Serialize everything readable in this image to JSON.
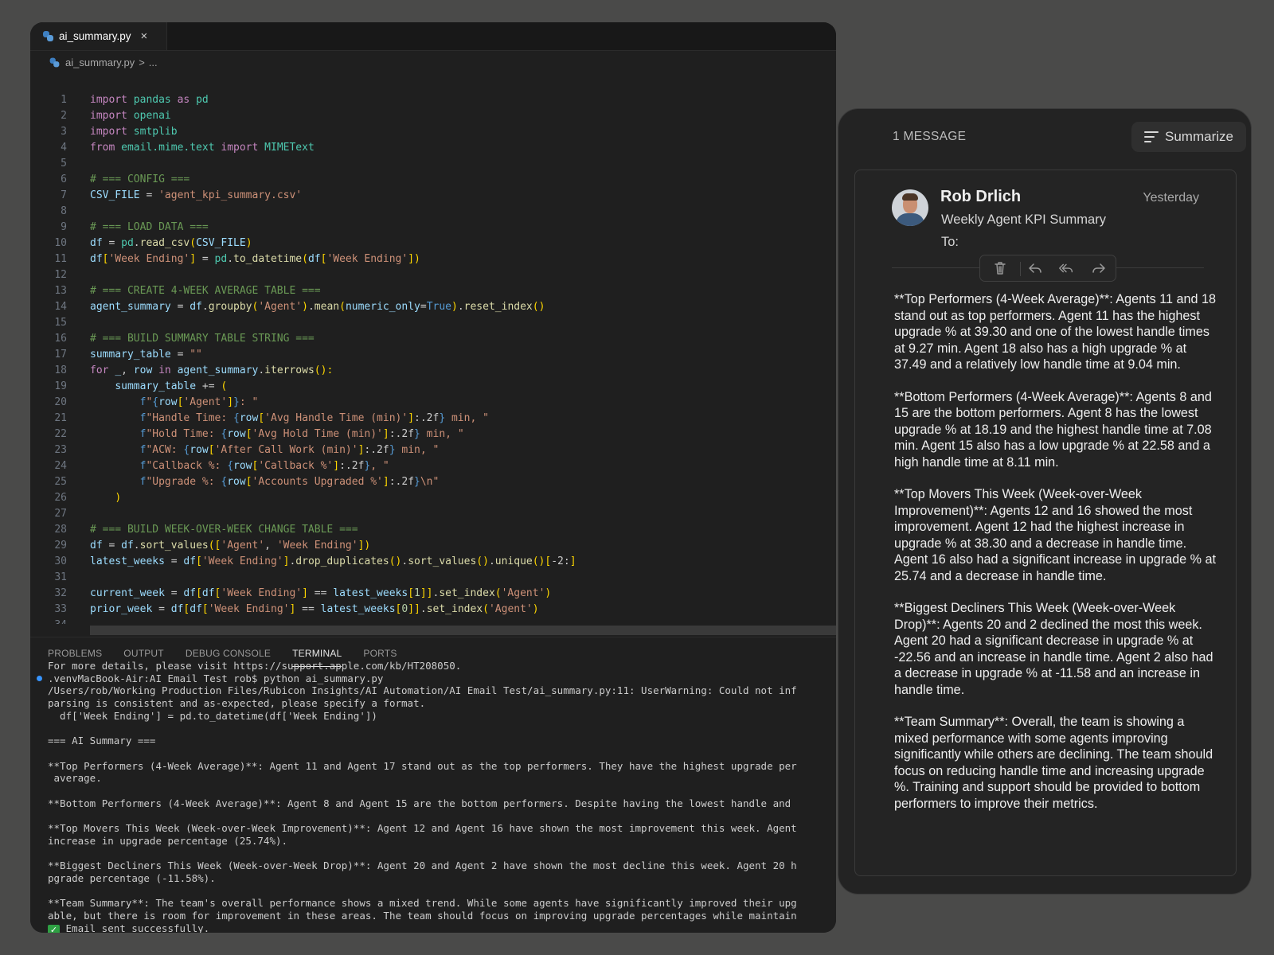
{
  "editor": {
    "tab": {
      "label": "ai_summary.py",
      "close": "×"
    },
    "breadcrumb": {
      "file": "ai_summary.py",
      "sep": ">",
      "rest": "..."
    },
    "code_lines": [
      [
        [
          "k",
          "import"
        ],
        [
          "d",
          " "
        ],
        [
          "m",
          "pandas"
        ],
        [
          "d",
          " "
        ],
        [
          "k",
          "as"
        ],
        [
          "d",
          " "
        ],
        [
          "m",
          "pd"
        ]
      ],
      [
        [
          "k",
          "import"
        ],
        [
          "d",
          " "
        ],
        [
          "m",
          "openai"
        ]
      ],
      [
        [
          "k",
          "import"
        ],
        [
          "d",
          " "
        ],
        [
          "m",
          "smtplib"
        ]
      ],
      [
        [
          "k",
          "from"
        ],
        [
          "d",
          " "
        ],
        [
          "m",
          "email.mime.text"
        ],
        [
          "d",
          " "
        ],
        [
          "k",
          "import"
        ],
        [
          "d",
          " "
        ],
        [
          "m",
          "MIMEText"
        ]
      ],
      [],
      [
        [
          "c",
          "# === CONFIG ==="
        ]
      ],
      [
        [
          "v",
          "CSV_FILE"
        ],
        [
          "d",
          " = "
        ],
        [
          "s",
          "'agent_kpi_summary.csv'"
        ]
      ],
      [],
      [
        [
          "c",
          "# === LOAD DATA ==="
        ]
      ],
      [
        [
          "v",
          "df"
        ],
        [
          "d",
          " = "
        ],
        [
          "m",
          "pd"
        ],
        [
          "d",
          "."
        ],
        [
          "f",
          "read_csv"
        ],
        [
          "p",
          "("
        ],
        [
          "v",
          "CSV_FILE"
        ],
        [
          "p",
          ")"
        ]
      ],
      [
        [
          "v",
          "df"
        ],
        [
          "p",
          "["
        ],
        [
          "s",
          "'Week Ending'"
        ],
        [
          "p",
          "]"
        ],
        [
          "d",
          " = "
        ],
        [
          "m",
          "pd"
        ],
        [
          "d",
          "."
        ],
        [
          "f",
          "to_datetime"
        ],
        [
          "p",
          "("
        ],
        [
          "v",
          "df"
        ],
        [
          "p",
          "["
        ],
        [
          "s",
          "'Week Ending'"
        ],
        [
          "p",
          "])"
        ]
      ],
      [],
      [
        [
          "c",
          "# === CREATE 4-WEEK AVERAGE TABLE ==="
        ]
      ],
      [
        [
          "v",
          "agent_summary"
        ],
        [
          "d",
          " = "
        ],
        [
          "v",
          "df"
        ],
        [
          "d",
          "."
        ],
        [
          "f",
          "groupby"
        ],
        [
          "p",
          "("
        ],
        [
          "s",
          "'Agent'"
        ],
        [
          "p",
          ")"
        ],
        [
          "d",
          "."
        ],
        [
          "f",
          "mean"
        ],
        [
          "p",
          "("
        ],
        [
          "v",
          "numeric_only"
        ],
        [
          "d",
          "="
        ],
        [
          "b",
          "True"
        ],
        [
          "p",
          ")"
        ],
        [
          "d",
          "."
        ],
        [
          "f",
          "reset_index"
        ],
        [
          "p",
          "()"
        ]
      ],
      [],
      [
        [
          "c",
          "# === BUILD SUMMARY TABLE STRING ==="
        ]
      ],
      [
        [
          "v",
          "summary_table"
        ],
        [
          "d",
          " = "
        ],
        [
          "s",
          "\"\""
        ]
      ],
      [
        [
          "k",
          "for"
        ],
        [
          "d",
          " "
        ],
        [
          "v",
          "_"
        ],
        [
          "d",
          ", "
        ],
        [
          "v",
          "row"
        ],
        [
          "d",
          " "
        ],
        [
          "k",
          "in"
        ],
        [
          "d",
          " "
        ],
        [
          "v",
          "agent_summary"
        ],
        [
          "d",
          "."
        ],
        [
          "f",
          "iterrows"
        ],
        [
          "p",
          "():"
        ]
      ],
      [
        [
          "d",
          "    "
        ],
        [
          "v",
          "summary_table"
        ],
        [
          "d",
          " += "
        ],
        [
          "p",
          "("
        ]
      ],
      [
        [
          "d",
          "        "
        ],
        [
          "b",
          "f"
        ],
        [
          "s",
          "\""
        ],
        [
          "b",
          "{"
        ],
        [
          "v",
          "row"
        ],
        [
          "p",
          "["
        ],
        [
          "s",
          "'Agent'"
        ],
        [
          "p",
          "]"
        ],
        [
          "b",
          "}"
        ],
        [
          "s",
          ": \""
        ]
      ],
      [
        [
          "d",
          "        "
        ],
        [
          "b",
          "f"
        ],
        [
          "s",
          "\"Handle Time: "
        ],
        [
          "b",
          "{"
        ],
        [
          "v",
          "row"
        ],
        [
          "p",
          "["
        ],
        [
          "s",
          "'Avg Handle Time (min)'"
        ],
        [
          "p",
          "]"
        ],
        [
          "d",
          ":.2f"
        ],
        [
          "b",
          "}"
        ],
        [
          "s",
          " min, \""
        ]
      ],
      [
        [
          "d",
          "        "
        ],
        [
          "b",
          "f"
        ],
        [
          "s",
          "\"Hold Time: "
        ],
        [
          "b",
          "{"
        ],
        [
          "v",
          "row"
        ],
        [
          "p",
          "["
        ],
        [
          "s",
          "'Avg Hold Time (min)'"
        ],
        [
          "p",
          "]"
        ],
        [
          "d",
          ":.2f"
        ],
        [
          "b",
          "}"
        ],
        [
          "s",
          " min, \""
        ]
      ],
      [
        [
          "d",
          "        "
        ],
        [
          "b",
          "f"
        ],
        [
          "s",
          "\"ACW: "
        ],
        [
          "b",
          "{"
        ],
        [
          "v",
          "row"
        ],
        [
          "p",
          "["
        ],
        [
          "s",
          "'After Call Work (min)'"
        ],
        [
          "p",
          "]"
        ],
        [
          "d",
          ":.2f"
        ],
        [
          "b",
          "}"
        ],
        [
          "s",
          " min, \""
        ]
      ],
      [
        [
          "d",
          "        "
        ],
        [
          "b",
          "f"
        ],
        [
          "s",
          "\"Callback %: "
        ],
        [
          "b",
          "{"
        ],
        [
          "v",
          "row"
        ],
        [
          "p",
          "["
        ],
        [
          "s",
          "'Callback %'"
        ],
        [
          "p",
          "]"
        ],
        [
          "d",
          ":.2f"
        ],
        [
          "b",
          "}"
        ],
        [
          "s",
          ", \""
        ]
      ],
      [
        [
          "d",
          "        "
        ],
        [
          "b",
          "f"
        ],
        [
          "s",
          "\"Upgrade %: "
        ],
        [
          "b",
          "{"
        ],
        [
          "v",
          "row"
        ],
        [
          "p",
          "["
        ],
        [
          "s",
          "'Accounts Upgraded %'"
        ],
        [
          "p",
          "]"
        ],
        [
          "d",
          ":.2f"
        ],
        [
          "b",
          "}"
        ],
        [
          "s",
          "\\n\""
        ]
      ],
      [
        [
          "d",
          "    "
        ],
        [
          "p",
          ")"
        ]
      ],
      [],
      [
        [
          "c",
          "# === BUILD WEEK-OVER-WEEK CHANGE TABLE ==="
        ]
      ],
      [
        [
          "v",
          "df"
        ],
        [
          "d",
          " = "
        ],
        [
          "v",
          "df"
        ],
        [
          "d",
          "."
        ],
        [
          "f",
          "sort_values"
        ],
        [
          "p",
          "(["
        ],
        [
          "s",
          "'Agent'"
        ],
        [
          "d",
          ", "
        ],
        [
          "s",
          "'Week Ending'"
        ],
        [
          "p",
          "])"
        ]
      ],
      [
        [
          "v",
          "latest_weeks"
        ],
        [
          "d",
          " = "
        ],
        [
          "v",
          "df"
        ],
        [
          "p",
          "["
        ],
        [
          "s",
          "'Week Ending'"
        ],
        [
          "p",
          "]"
        ],
        [
          "d",
          "."
        ],
        [
          "f",
          "drop_duplicates"
        ],
        [
          "p",
          "()"
        ],
        [
          "d",
          "."
        ],
        [
          "f",
          "sort_values"
        ],
        [
          "p",
          "()"
        ],
        [
          "d",
          "."
        ],
        [
          "f",
          "unique"
        ],
        [
          "p",
          "()"
        ],
        [
          "p",
          "["
        ],
        [
          "d",
          "-2:"
        ],
        [
          "p",
          "]"
        ]
      ],
      [],
      [
        [
          "v",
          "current_week"
        ],
        [
          "d",
          " = "
        ],
        [
          "v",
          "df"
        ],
        [
          "p",
          "["
        ],
        [
          "v",
          "df"
        ],
        [
          "p",
          "["
        ],
        [
          "s",
          "'Week Ending'"
        ],
        [
          "p",
          "]"
        ],
        [
          "d",
          " == "
        ],
        [
          "v",
          "latest_weeks"
        ],
        [
          "p",
          "["
        ],
        [
          "n",
          "1"
        ],
        [
          "p",
          "]]"
        ],
        [
          "d",
          "."
        ],
        [
          "f",
          "set_index"
        ],
        [
          "p",
          "("
        ],
        [
          "s",
          "'Agent'"
        ],
        [
          "p",
          ")"
        ]
      ],
      [
        [
          "v",
          "prior_week"
        ],
        [
          "d",
          " = "
        ],
        [
          "v",
          "df"
        ],
        [
          "p",
          "["
        ],
        [
          "v",
          "df"
        ],
        [
          "p",
          "["
        ],
        [
          "s",
          "'Week Ending'"
        ],
        [
          "p",
          "]"
        ],
        [
          "d",
          " == "
        ],
        [
          "v",
          "latest_weeks"
        ],
        [
          "p",
          "["
        ],
        [
          "n",
          "0"
        ],
        [
          "p",
          "]]"
        ],
        [
          "d",
          "."
        ],
        [
          "f",
          "set_index"
        ],
        [
          "p",
          "("
        ],
        [
          "s",
          "'Agent'"
        ],
        [
          "p",
          ")"
        ]
      ],
      []
    ],
    "panel_tabs": [
      "PROBLEMS",
      "OUTPUT",
      "DEBUG CONSOLE",
      "TERMINAL",
      "PORTS"
    ],
    "active_panel_tab": "TERMINAL",
    "terminal_lines": [
      "For more details, please visit https://support.apple.com/kb/HT208050.",
      ".venvMacBook-Air:AI Email Test rob$ python ai_summary.py",
      "/Users/rob/Working Production Files/Rubicon Insights/AI Automation/AI Email Test/ai_summary.py:11: UserWarning: Could not inf",
      "parsing is consistent and as-expected, please specify a format.",
      "  df['Week Ending'] = pd.to_datetime(df['Week Ending'])",
      "",
      "=== AI Summary ===",
      "",
      "**Top Performers (4-Week Average)**: Agent 11 and Agent 17 stand out as the top performers. They have the highest upgrade per",
      " average.",
      "",
      "**Bottom Performers (4-Week Average)**: Agent 8 and Agent 15 are the bottom performers. Despite having the lowest handle and",
      "",
      "**Top Movers This Week (Week-over-Week Improvement)**: Agent 12 and Agent 16 have shown the most improvement this week. Agent",
      "increase in upgrade percentage (25.74%).",
      "",
      "**Biggest Decliners This Week (Week-over-Week Drop)**: Agent 20 and Agent 2 have shown the most decline this week. Agent 20 h",
      "pgrade percentage (-11.58%).",
      "",
      "**Team Summary**: The team's overall performance shows a mixed trend. While some agents have significantly improved their upg",
      "able, but there is room for improvement in these areas. The team should focus on improving upgrade percentages while maintain"
    ],
    "terminal_success": "Email sent successfully.",
    "terminal_prompt": ".venvMacBook-Air:AI Email Test rob$ "
  },
  "mail": {
    "message_count": "1 MESSAGE",
    "summarize_label": "Summarize",
    "sender": "Rob Drlich",
    "date": "Yesterday",
    "subject": "Weekly Agent KPI Summary",
    "to_label": "To:",
    "actions": [
      "trash-icon",
      "reply-icon",
      "reply-all-icon",
      "forward-icon"
    ],
    "body_paragraphs": [
      "**Top Performers (4-Week Average)**: Agents 11 and 18 stand out as top performers. Agent 11 has the highest upgrade % at 39.30 and one of the lowest handle times at 9.27 min. Agent 18 also has a high upgrade % at 37.49 and a relatively low handle time at 9.04 min.",
      "**Bottom Performers (4-Week Average)**: Agents 8 and 15 are the bottom performers. Agent 8 has the lowest upgrade % at 18.19 and the highest handle time at 7.08 min. Agent 15 also has a low upgrade % at 22.58 and a high handle time at 8.11 min.",
      "**Top Movers This Week (Week-over-Week Improvement)**: Agents 12 and 16 showed the most improvement. Agent 12 had the highest increase in upgrade % at 38.30 and a decrease in handle time. Agent 16 also had a significant increase in upgrade % at 25.74 and a decrease in handle time.",
      "**Biggest Decliners This Week (Week-over-Week Drop)**: Agents 20 and 2 declined the most this week. Agent 20 had a significant decrease in upgrade % at -22.56 and an increase in handle time. Agent 2 also had a decrease in upgrade % at -11.58 and an increase in handle time.",
      "**Team Summary**: Overall, the team is showing a mixed performance with some agents improving significantly while others are declining. The team should focus on reducing handle time and increasing upgrade %. Training and support should be provided to bottom performers to improve their metrics."
    ]
  },
  "colors": {
    "desktop": "#4a4a49",
    "editor_bg": "#1f1f1f",
    "keyword": "#c586c0",
    "string": "#ce9178",
    "comment": "#6a9955",
    "module": "#4ec9b0",
    "variable": "#9cdcfe",
    "function": "#dcdcaa",
    "terminal_dot": "#3794ff",
    "success": "#2ea043"
  }
}
